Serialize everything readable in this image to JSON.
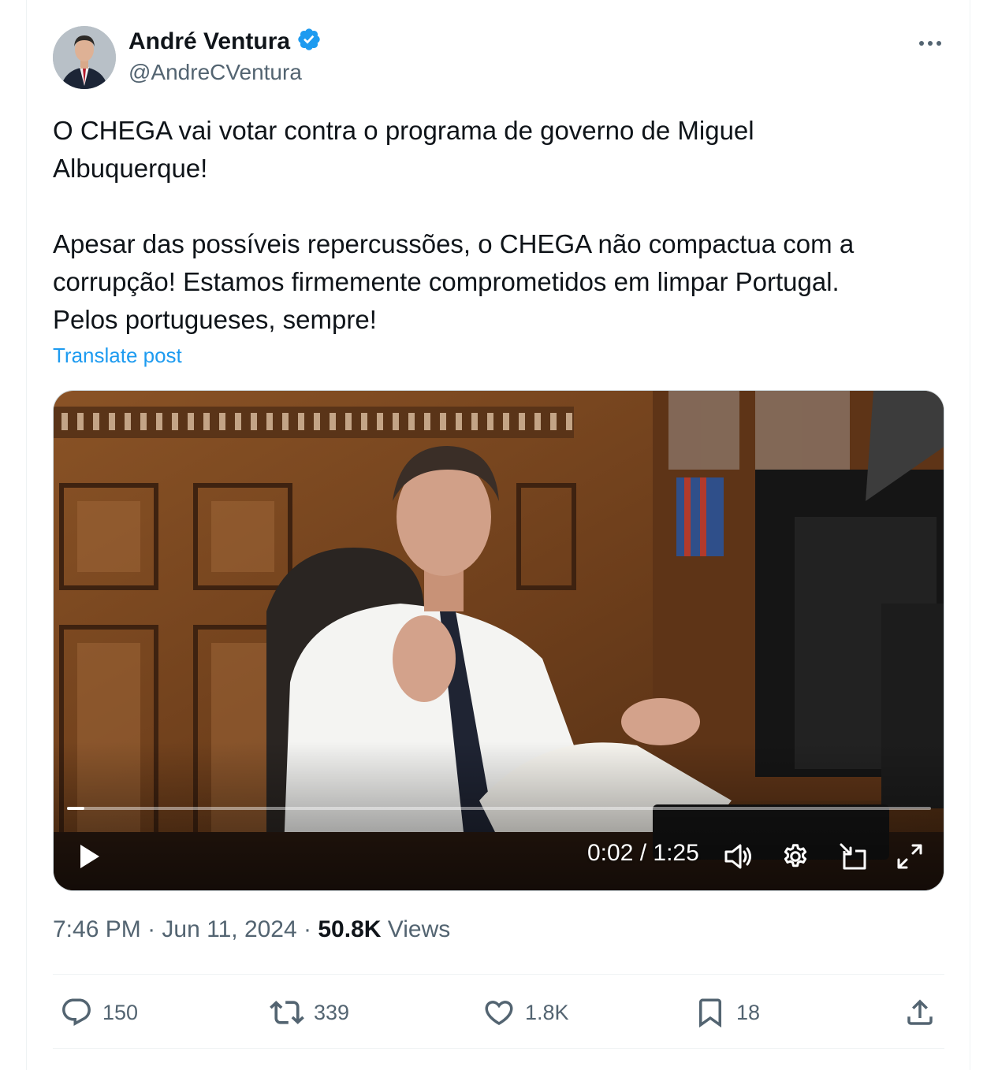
{
  "author": {
    "name": "André Ventura",
    "handle": "@AndreCVentura",
    "verified_color": "#1d9bf0"
  },
  "post": {
    "paragraph_1": "O CHEGA vai votar contra o programa de governo de Miguel Albuquerque!",
    "paragraph_2": "Apesar das possíveis repercussões, o CHEGA não compactua com a corrupção! Estamos firmemente comprometidos em limpar Portugal.",
    "paragraph_3": "Pelos portugueses, sempre!",
    "translate_label": "Translate post"
  },
  "video": {
    "time_display": "0:02 / 1:25",
    "progress_fraction": 0.02,
    "icons": [
      "play-icon",
      "volume-icon",
      "settings-icon",
      "pip-icon",
      "fullscreen-icon"
    ]
  },
  "meta": {
    "time": "7:46 PM",
    "date": "Jun 11, 2024",
    "separator": "·",
    "views_count": "50.8K",
    "views_label": "Views"
  },
  "actions": {
    "replies": "150",
    "reposts": "339",
    "likes": "1.8K",
    "bookmarks": "18"
  },
  "colors": {
    "accent": "#1d9bf0",
    "secondary_text": "#536471",
    "primary_text": "#0f1419"
  }
}
